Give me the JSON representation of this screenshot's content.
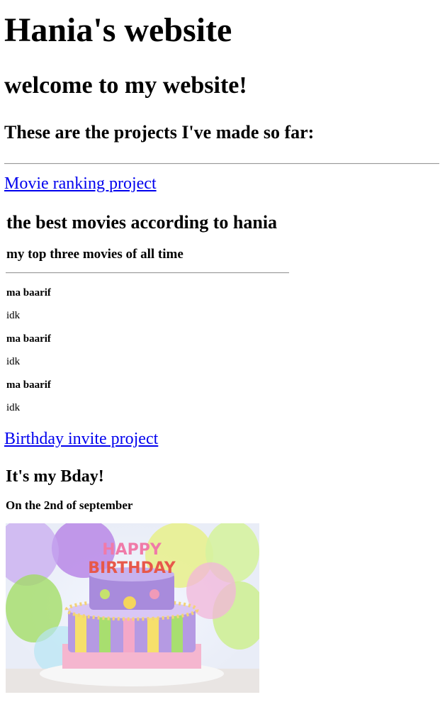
{
  "header": {
    "title": "Hania's website",
    "welcome": "welcome to my website!",
    "projects_intro": "These are the projects I've made so far:"
  },
  "projects": {
    "movie": {
      "link_label": "Movie ranking project",
      "heading": "the best movies according to hania",
      "subheading": "my top three movies of all time",
      "items": [
        {
          "title": "ma baarif",
          "description": "idk"
        },
        {
          "title": "ma baarif",
          "description": "idk"
        },
        {
          "title": "ma baarif",
          "description": "idk"
        }
      ]
    },
    "birthday": {
      "link_label": "Birthday invite project",
      "heading": "It's my Bday!",
      "date_line": "On the 2nd of september",
      "candles_text_top": "HAPPY",
      "candles_text_bottom": "BIRTHDAY"
    }
  }
}
